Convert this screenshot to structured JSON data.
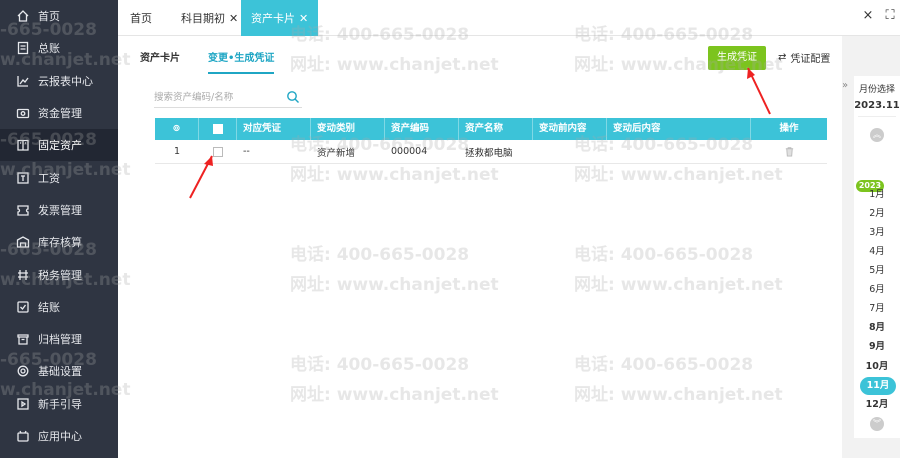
{
  "sidebar": {
    "items": [
      {
        "label": "首页",
        "icon": "home-icon"
      },
      {
        "label": "总账",
        "icon": "ledger-icon"
      },
      {
        "label": "云报表中心",
        "icon": "chart-icon"
      },
      {
        "label": "资金管理",
        "icon": "money-icon"
      },
      {
        "label": "固定资产",
        "icon": "asset-icon"
      },
      {
        "label": "工资",
        "icon": "salary-icon"
      },
      {
        "label": "发票管理",
        "icon": "invoice-icon"
      },
      {
        "label": "库存核算",
        "icon": "inventory-icon"
      },
      {
        "label": "税务管理",
        "icon": "tax-icon"
      },
      {
        "label": "结账",
        "icon": "close-account-icon"
      },
      {
        "label": "归档管理",
        "icon": "archive-icon"
      },
      {
        "label": "基础设置",
        "icon": "settings-icon"
      },
      {
        "label": "新手引导",
        "icon": "guide-icon"
      },
      {
        "label": "应用中心",
        "icon": "app-center-icon"
      }
    ],
    "active_index": 4
  },
  "tabs": [
    {
      "label": "首页",
      "closable": false
    },
    {
      "label": "科目期初",
      "closable": true
    },
    {
      "label": "资产卡片",
      "closable": true,
      "active": true
    }
  ],
  "window": {
    "close": "×",
    "fullscreen": "⛶"
  },
  "subtabs": [
    {
      "label": "资产卡片"
    },
    {
      "label": "变更•生成凭证",
      "active": true
    }
  ],
  "toolbar": {
    "generate_label": "生成凭证",
    "config_label": "凭证配置"
  },
  "search": {
    "placeholder": "搜索资产编码/名称"
  },
  "table": {
    "headers": [
      "对应凭证",
      "变动类别",
      "资产编码",
      "资产名称",
      "变动前内容",
      "变动后内容",
      "操作"
    ],
    "rows": [
      {
        "index": "1",
        "voucher": "--",
        "type": "资产新增",
        "code": "000004",
        "name": "拯救都电脑",
        "before": "",
        "after": ""
      }
    ]
  },
  "month_selector": {
    "label": "月份选择",
    "value": "2023.11",
    "year_badge": "2023",
    "months": [
      "1月",
      "2月",
      "3月",
      "4月",
      "5月",
      "6月",
      "7月",
      "8月",
      "9月",
      "10月",
      "11月",
      "12月"
    ],
    "selected": "11月"
  },
  "watermark": {
    "phone": "电话: 400-665-0028",
    "site": "网址: www.chanjet.net",
    "phone_short": "-665-0028",
    "site_short": "w.chanjet.net"
  },
  "colors": {
    "accent": "#3cc3d8",
    "green": "#7cc41e",
    "sidebar": "#2f3542"
  }
}
